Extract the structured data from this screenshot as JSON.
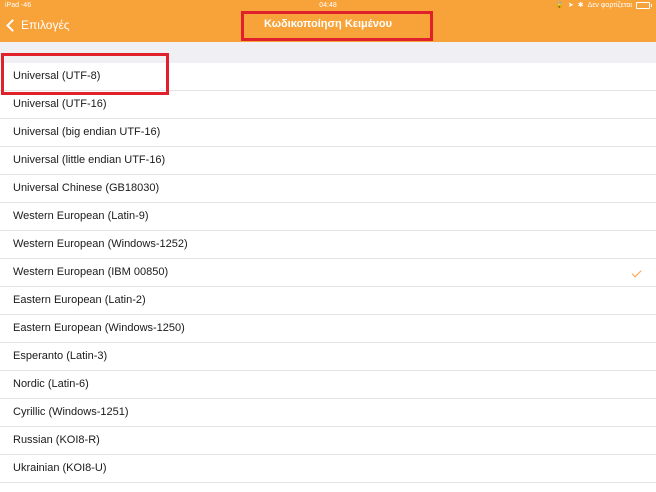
{
  "status_bar": {
    "device": "iPad",
    "signal": "-46",
    "time": "04:48",
    "charging_text": "Δεν φορτίζεται"
  },
  "navbar": {
    "back_label": "Επιλογές",
    "title": "Κωδικοποίηση Κειμένου"
  },
  "colors": {
    "accent": "#f8a23a",
    "highlight": "#e0202a"
  },
  "encodings": [
    {
      "label": "Universal (UTF-8)",
      "selected": false
    },
    {
      "label": "Universal (UTF-16)",
      "selected": false
    },
    {
      "label": "Universal (big endian UTF-16)",
      "selected": false
    },
    {
      "label": "Universal (little endian UTF-16)",
      "selected": false
    },
    {
      "label": "Universal Chinese (GB18030)",
      "selected": false
    },
    {
      "label": "Western European (Latin-9)",
      "selected": false
    },
    {
      "label": "Western European (Windows-1252)",
      "selected": false
    },
    {
      "label": "Western European (IBM 00850)",
      "selected": true
    },
    {
      "label": "Eastern European (Latin-2)",
      "selected": false
    },
    {
      "label": "Eastern European (Windows-1250)",
      "selected": false
    },
    {
      "label": "Esperanto (Latin-3)",
      "selected": false
    },
    {
      "label": "Nordic (Latin-6)",
      "selected": false
    },
    {
      "label": "Cyrillic (Windows-1251)",
      "selected": false
    },
    {
      "label": "Russian (KOI8-R)",
      "selected": false
    },
    {
      "label": "Ukrainian (KOI8-U)",
      "selected": false
    }
  ]
}
